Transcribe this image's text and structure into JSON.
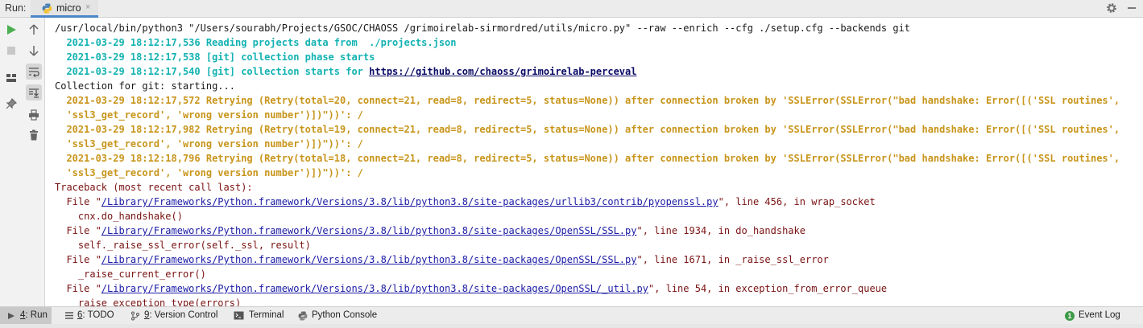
{
  "run_label": "Run:",
  "tab": {
    "label": "micro",
    "close": "×"
  },
  "toolbar": {
    "rerun_icon": "play-icon",
    "stop_icon": "stop-icon",
    "colors": {
      "run": "#4caf50",
      "accent": "#4a86c8"
    }
  },
  "console": {
    "lines": [
      {
        "segments": [
          {
            "t": "/usr/local/bin/python3 \"/Users/sourabh/Projects/GSOC/CHAOSS /grimoirelab-sirmordred/utils/micro.py\" --raw --enrich --cfg ./setup.cfg --backends git",
            "c": "black"
          }
        ]
      },
      {
        "segments": [
          {
            "t": "  2021-03-29 18:12:17,536 Reading projects data from  ./projects.json",
            "c": "teal"
          }
        ]
      },
      {
        "segments": [
          {
            "t": "  2021-03-29 18:12:17,538 [git] collection phase starts",
            "c": "teal"
          }
        ]
      },
      {
        "segments": [
          {
            "t": "  2021-03-29 18:12:17,540 [git] collection starts for ",
            "c": "teal"
          },
          {
            "t": "https://github.com/chaoss/grimoirelab-perceval",
            "c": "link-b"
          }
        ]
      },
      {
        "segments": [
          {
            "t": "Collection for git: starting...",
            "c": "black"
          }
        ]
      },
      {
        "segments": [
          {
            "t": "  2021-03-29 18:12:17,572 Retrying (Retry(total=20, connect=21, read=8, redirect=5, status=None)) after connection broken by 'SSLError(SSLError(\"bad handshake: Error([('SSL routines',",
            "c": "gold"
          }
        ]
      },
      {
        "segments": [
          {
            "t": "  'ssl3_get_record', 'wrong version number')])\"))': /",
            "c": "gold"
          }
        ]
      },
      {
        "segments": [
          {
            "t": "  2021-03-29 18:12:17,982 Retrying (Retry(total=19, connect=21, read=8, redirect=5, status=None)) after connection broken by 'SSLError(SSLError(\"bad handshake: Error([('SSL routines',",
            "c": "gold"
          }
        ]
      },
      {
        "segments": [
          {
            "t": "  'ssl3_get_record', 'wrong version number')])\"))': /",
            "c": "gold"
          }
        ]
      },
      {
        "segments": [
          {
            "t": "  2021-03-29 18:12:18,796 Retrying (Retry(total=18, connect=21, read=8, redirect=5, status=None)) after connection broken by 'SSLError(SSLError(\"bad handshake: Error([('SSL routines',",
            "c": "gold"
          }
        ]
      },
      {
        "segments": [
          {
            "t": "  'ssl3_get_record', 'wrong version number')])\"))': /",
            "c": "gold"
          }
        ]
      },
      {
        "segments": [
          {
            "t": "Traceback (most recent call last):",
            "c": "red"
          }
        ]
      },
      {
        "segments": [
          {
            "t": "  File \"",
            "c": "red"
          },
          {
            "t": "/Library/Frameworks/Python.framework/Versions/3.8/lib/python3.8/site-packages/urllib3/contrib/pyopenssl.py",
            "c": "link"
          },
          {
            "t": "\", line 456, in wrap_socket",
            "c": "red"
          }
        ]
      },
      {
        "segments": [
          {
            "t": "    cnx.do_handshake()",
            "c": "red"
          }
        ]
      },
      {
        "segments": [
          {
            "t": "  File \"",
            "c": "red"
          },
          {
            "t": "/Library/Frameworks/Python.framework/Versions/3.8/lib/python3.8/site-packages/OpenSSL/SSL.py",
            "c": "link"
          },
          {
            "t": "\", line 1934, in do_handshake",
            "c": "red"
          }
        ]
      },
      {
        "segments": [
          {
            "t": "    self._raise_ssl_error(self._ssl, result)",
            "c": "red"
          }
        ]
      },
      {
        "segments": [
          {
            "t": "  File \"",
            "c": "red"
          },
          {
            "t": "/Library/Frameworks/Python.framework/Versions/3.8/lib/python3.8/site-packages/OpenSSL/SSL.py",
            "c": "link"
          },
          {
            "t": "\", line 1671, in _raise_ssl_error",
            "c": "red"
          }
        ]
      },
      {
        "segments": [
          {
            "t": "    _raise_current_error()",
            "c": "red"
          }
        ]
      },
      {
        "segments": [
          {
            "t": "  File \"",
            "c": "red"
          },
          {
            "t": "/Library/Frameworks/Python.framework/Versions/3.8/lib/python3.8/site-packages/OpenSSL/_util.py",
            "c": "link"
          },
          {
            "t": "\", line 54, in exception_from_error_queue",
            "c": "red"
          }
        ]
      },
      {
        "segments": [
          {
            "t": "    raise exception_type(errors)",
            "c": "red"
          }
        ]
      }
    ]
  },
  "bottom": {
    "run": {
      "num": "4",
      "label": ": Run"
    },
    "todo": {
      "num": "6",
      "label": ": TODO"
    },
    "vc": {
      "num": "9",
      "label": ": Version Control"
    },
    "terminal": "Terminal",
    "python_console": "Python Console",
    "event_log": {
      "count": "1",
      "label": "Event Log"
    }
  }
}
